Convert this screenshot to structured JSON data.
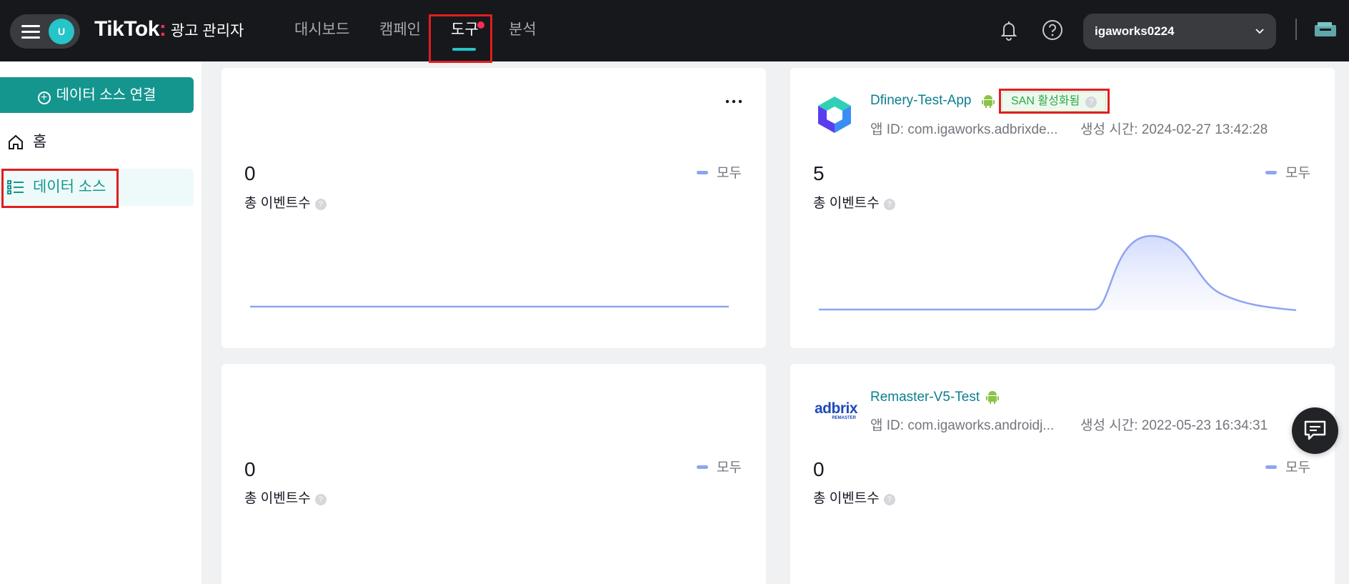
{
  "header": {
    "brand": "TikTok",
    "brand_dot": ":",
    "brand_sub": "광고 관리자",
    "avatar_initial": "U",
    "nav": [
      {
        "label": "대시보드"
      },
      {
        "label": "캠페인"
      },
      {
        "label": "도구",
        "active": true
      },
      {
        "label": "분석"
      }
    ],
    "account": "igaworks0224",
    "icons": [
      "menu-icon",
      "bell-icon",
      "help-icon",
      "chevron-down-icon",
      "ticket-icon"
    ]
  },
  "sidebar": {
    "connect_button": "데이터 소스 연결",
    "items": [
      {
        "label": "홈",
        "icon": "home-icon"
      },
      {
        "label": "데이터 소스",
        "icon": "list-icon",
        "active": true
      }
    ]
  },
  "cards": [
    {
      "metric_value": "0",
      "metric_label": "총 이벤트수",
      "legend": "모두"
    },
    {
      "app_name": "Dfinery-Test-App",
      "badge": "SAN 활성화됨",
      "app_id": "앱 ID: com.igaworks.adbrixde...",
      "created": "생성 시간: 2024-02-27 13:42:28",
      "metric_value": "5",
      "metric_label": "총 이벤트수",
      "legend": "모두"
    },
    {
      "metric_value": "0",
      "metric_label": "총 이벤트수",
      "legend": "모두"
    },
    {
      "app_name": "Remaster-V5-Test",
      "logo_text": "adbrix",
      "logo_sub": "REMASTER",
      "app_id": "앱 ID: com.igaworks.androidj...",
      "created": "생성 시간: 2022-05-23 16:34:31",
      "metric_value": "0",
      "metric_label": "총 이벤트수",
      "legend": "모두"
    }
  ],
  "colors": {
    "topbar": "#17181b",
    "accent_teal": "#14968f",
    "line_series": "#8ea4f2",
    "highlight_red": "#e01e1e"
  }
}
